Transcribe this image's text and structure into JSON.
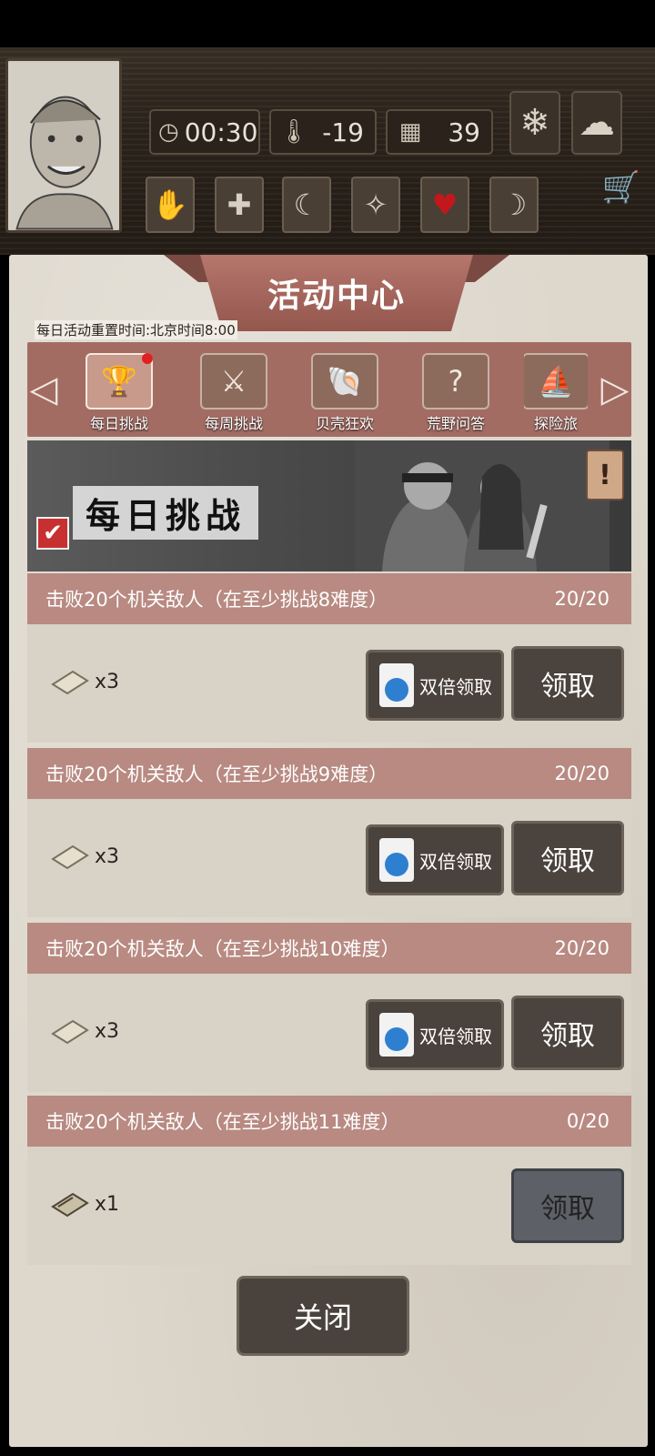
{
  "header": {
    "time": "00:30",
    "temperature": "-19",
    "day": "39"
  },
  "panel": {
    "title": "活动中心",
    "reset_note": "每日活动重置时间:北京时间8:00",
    "tabs": [
      {
        "label": "每日挑战",
        "active": true,
        "has_dot": true
      },
      {
        "label": "每周挑战",
        "active": false
      },
      {
        "label": "贝壳狂欢",
        "active": false
      },
      {
        "label": "荒野问答",
        "active": false
      },
      {
        "label": "探险旅",
        "active": false
      }
    ],
    "banner_title": "每日挑战",
    "banner_info": "!",
    "tasks": [
      {
        "title": "击败20个机关敌人（在至少挑战8难度）",
        "progress": "20/20",
        "reward_qty": "x3",
        "double_label": "双倍领取",
        "claim_label": "领取",
        "claimable": true
      },
      {
        "title": "击败20个机关敌人（在至少挑战9难度）",
        "progress": "20/20",
        "reward_qty": "x3",
        "double_label": "双倍领取",
        "claim_label": "领取",
        "claimable": true
      },
      {
        "title": "击败20个机关敌人（在至少挑战10难度）",
        "progress": "20/20",
        "reward_qty": "x3",
        "double_label": "双倍领取",
        "claim_label": "领取",
        "claimable": true
      },
      {
        "title": "击败20个机关敌人（在至少挑战11难度）",
        "progress": "0/20",
        "reward_qty": "x1",
        "claim_label": "领取",
        "claimable": false
      }
    ],
    "close_label": "关闭"
  },
  "icons": [
    "clock-icon",
    "thermometer-icon",
    "calendar-icon",
    "snowflake-icon",
    "snow-cloud-icon",
    "bandaged-hand-icon",
    "health-cross-icon",
    "stomach-icon",
    "mind-icon",
    "heart-icon",
    "moon-icon",
    "shopping-cart-icon"
  ]
}
